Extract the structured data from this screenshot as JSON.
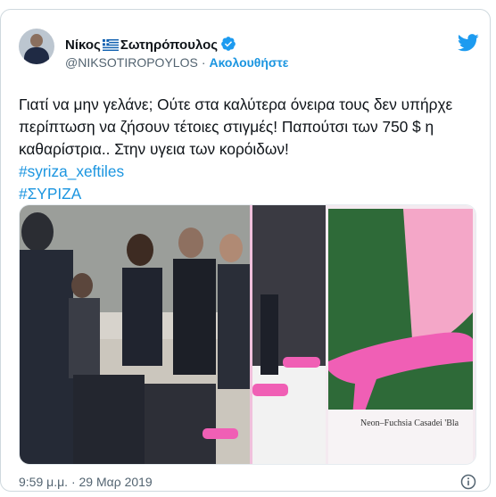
{
  "author": {
    "name_before_flag": "Νίκος",
    "name_after_flag": "Σωτηρόπουλος",
    "handle": "@NIKSOTIROPOYLOS",
    "follow_label": "Ακολουθήστε",
    "separator": "·"
  },
  "tweet": {
    "text": "Γιατί να μην γελάνε; Ούτε στα καλύτερα όνειρα τους δεν υπήρχε περίπτωση να ζήσουν τέτοιες στιγμές! Παπούτσι των 750 $ η καθαρίστρια.. Στην υγεια των κορόιδων!",
    "hashtags": [
      "#syriza_xeftiles",
      "#ΣΥΡΙΖΑ"
    ]
  },
  "media": {
    "caption": "Neon–Fuchsia Casadei 'Bla"
  },
  "footer": {
    "timestamp": "9:59 μ.μ. · 29 Μαρ 2019"
  },
  "colors": {
    "accent": "#1b95e0",
    "pink_shoe": "#f05fb5",
    "text": "#0f1419",
    "secondary": "#536471"
  },
  "icons": [
    "verified-badge-icon",
    "twitter-bird-icon",
    "info-icon",
    "greek-flag-icon"
  ]
}
